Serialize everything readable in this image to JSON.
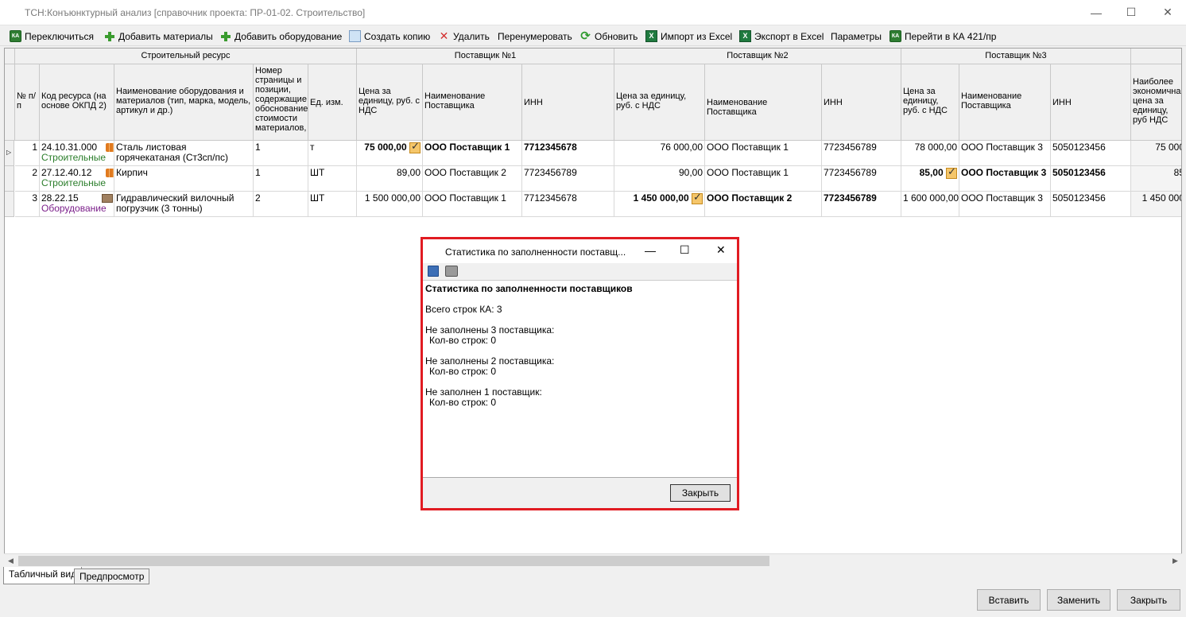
{
  "window": {
    "title": "ТСН:Конъюнктурный анализ [справочник проекта: ПР-01-02. Строительство]"
  },
  "toolbar": {
    "switch": "Переключиться",
    "add_materials": "Добавить материалы",
    "add_equipment": "Добавить оборудование",
    "create_copy": "Создать копию",
    "delete": "Удалить",
    "renumber": "Перенумеровать",
    "refresh": "Обновить",
    "import_excel": "Импорт из Excel",
    "export_excel": "Экспорт в Excel",
    "params": "Параметры",
    "goto_ka": "Перейти в КА 421/пр"
  },
  "grid": {
    "groups": {
      "resource": "Строительный ресурс",
      "sup1": "Поставщик №1",
      "sup2": "Поставщик №2",
      "sup3": "Поставщик №3"
    },
    "headers": {
      "num": "№ п/п",
      "code": "Код ресурса (на основе ОКПД 2)",
      "name": "Наименование оборудования и материалов (тип, марка, модель, артикул и др.)",
      "page": "Номер страницы и позиции, содержащие обоснование стоимости материалов,",
      "unit": "Ед. изм.",
      "price1": "Цена за единицу, руб. с НДС",
      "sname1": "Наименование Поставщика",
      "inn1": "ИНН",
      "price2": "Цена за единицу, руб. с НДС",
      "sname2": "Наименование Поставщика",
      "inn2": "ИНН",
      "price3": "Цена за единицу, руб. с НДС",
      "sname3": "Наименование Поставщика",
      "inn3": "ИНН",
      "best": "Наиболее экономична цена за единицу, руб НДС"
    },
    "rows": [
      {
        "num": "1",
        "code": "24.10.31.000",
        "category": "Строительные",
        "name": "Сталь листовая горячекатаная (Ст3сп/пс)",
        "page": "1",
        "unit": "т",
        "price1": "75 000,00",
        "sname1": "ООО Поставщик 1",
        "inn1": "7712345678",
        "price2": "76 000,00",
        "sname2": "ООО Поставщик 1",
        "inn2": "7723456789",
        "price3": "78 000,00",
        "sname3": "ООО Поставщик 3",
        "inn3": "5050123456",
        "best": "75 000"
      },
      {
        "num": "2",
        "code": "27.12.40.12",
        "category": "Строительные",
        "name": "Кирпич",
        "page": "1",
        "unit": "ШТ",
        "price1": "89,00",
        "sname1": "ООО Поставщик 2",
        "inn1": "7723456789",
        "price2": "90,00",
        "sname2": "ООО Поставщик 1",
        "inn2": "7723456789",
        "price3": "85,00",
        "sname3": "ООО Поставщик 3",
        "inn3": "5050123456",
        "best": "85"
      },
      {
        "num": "3",
        "code": "28.22.15",
        "category": "Оборудование",
        "name": "Гидравлический вилочный погрузчик (3 тонны)",
        "page": "2",
        "unit": "ШТ",
        "price1": "1 500 000,00",
        "sname1": "ООО Поставщик 1",
        "inn1": "7712345678",
        "price2": "1 450 000,00",
        "sname2": "ООО Поставщик 2",
        "inn2": "7723456789",
        "price3": "1 600 000,00",
        "sname3": "ООО Поставщик 3",
        "inn3": "5050123456",
        "best": "1 450 000"
      }
    ]
  },
  "tabs": {
    "table": "Табличный вид",
    "preview": "Предпросмотр"
  },
  "buttons": {
    "insert": "Вставить",
    "replace": "Заменить",
    "close": "Закрыть"
  },
  "dialog": {
    "title": "Статистика по заполненности поставщ...",
    "heading": "Статистика по заполненности поставщиков",
    "total": "Всего строк КА: 3",
    "not3": "Не заполнены 3 поставщика:",
    "not3_count": "Кол-во строк: 0",
    "not2": "Не заполнены 2 поставщика:",
    "not2_count": "Кол-во строк: 0",
    "not1": "Не заполнен 1 поставщик:",
    "not1_count": "Кол-во строк: 0",
    "close_button": "Закрыть"
  }
}
